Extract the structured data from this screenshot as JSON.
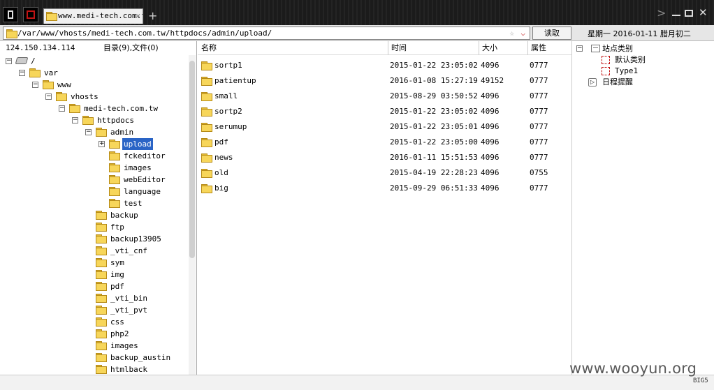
{
  "tab": {
    "title": "www.medi-tech.com.tw",
    "close": "✕",
    "new": "+"
  },
  "address": {
    "path": "/var/www/vhosts/medi-tech.com.tw/httpdocs/admin/upload/",
    "star": "☆",
    "dropdown": "⌵"
  },
  "read_button": "读取",
  "date_info": "星期一 2016-01-11 腊月初二",
  "left": {
    "ip": "124.150.134.114",
    "summary": "目录(9),文件(0)",
    "tree": [
      {
        "label": "/",
        "depth": 0,
        "toggle": "−",
        "icon": "drive"
      },
      {
        "label": "var",
        "depth": 1,
        "toggle": "−",
        "icon": "folder"
      },
      {
        "label": "www",
        "depth": 2,
        "toggle": "−",
        "icon": "folder"
      },
      {
        "label": "vhosts",
        "depth": 3,
        "toggle": "−",
        "icon": "folder"
      },
      {
        "label": "medi-tech.com.tw",
        "depth": 4,
        "toggle": "−",
        "icon": "folder"
      },
      {
        "label": "httpdocs",
        "depth": 5,
        "toggle": "−",
        "icon": "folder"
      },
      {
        "label": "admin",
        "depth": 6,
        "toggle": "−",
        "icon": "folder"
      },
      {
        "label": "upload",
        "depth": 7,
        "toggle": "+",
        "icon": "folder",
        "selected": true
      },
      {
        "label": "fckeditor",
        "depth": 7,
        "toggle": "",
        "icon": "folder"
      },
      {
        "label": "images",
        "depth": 7,
        "toggle": "",
        "icon": "folder"
      },
      {
        "label": "webEditor",
        "depth": 7,
        "toggle": "",
        "icon": "folder"
      },
      {
        "label": "language",
        "depth": 7,
        "toggle": "",
        "icon": "folder"
      },
      {
        "label": "test",
        "depth": 7,
        "toggle": "",
        "icon": "folder"
      },
      {
        "label": "backup",
        "depth": 6,
        "toggle": "",
        "icon": "folder"
      },
      {
        "label": "ftp",
        "depth": 6,
        "toggle": "",
        "icon": "folder"
      },
      {
        "label": "backup13905",
        "depth": 6,
        "toggle": "",
        "icon": "folder"
      },
      {
        "label": "_vti_cnf",
        "depth": 6,
        "toggle": "",
        "icon": "folder"
      },
      {
        "label": "sym",
        "depth": 6,
        "toggle": "",
        "icon": "folder"
      },
      {
        "label": "img",
        "depth": 6,
        "toggle": "",
        "icon": "folder"
      },
      {
        "label": "pdf",
        "depth": 6,
        "toggle": "",
        "icon": "folder"
      },
      {
        "label": "_vti_bin",
        "depth": 6,
        "toggle": "",
        "icon": "folder"
      },
      {
        "label": "_vti_pvt",
        "depth": 6,
        "toggle": "",
        "icon": "folder"
      },
      {
        "label": "css",
        "depth": 6,
        "toggle": "",
        "icon": "folder"
      },
      {
        "label": "php2",
        "depth": 6,
        "toggle": "",
        "icon": "folder"
      },
      {
        "label": "images",
        "depth": 6,
        "toggle": "",
        "icon": "folder"
      },
      {
        "label": "backup_austin",
        "depth": 6,
        "toggle": "",
        "icon": "folder"
      },
      {
        "label": "htmlback",
        "depth": 6,
        "toggle": "",
        "icon": "folder"
      }
    ]
  },
  "list": {
    "headers": {
      "name": "名称",
      "time": "时间",
      "size": "大小",
      "attr": "属性"
    },
    "rows": [
      {
        "name": "sortp1",
        "time": "2015-01-22 23:05:02",
        "size": "4096",
        "attr": "0777"
      },
      {
        "name": "patientup",
        "time": "2016-01-08 15:27:19",
        "size": "49152",
        "attr": "0777"
      },
      {
        "name": "small",
        "time": "2015-08-29 03:50:52",
        "size": "4096",
        "attr": "0777"
      },
      {
        "name": "sortp2",
        "time": "2015-01-22 23:05:02",
        "size": "4096",
        "attr": "0777"
      },
      {
        "name": "serumup",
        "time": "2015-01-22 23:05:01",
        "size": "4096",
        "attr": "0777"
      },
      {
        "name": "pdf",
        "time": "2015-01-22 23:05:00",
        "size": "4096",
        "attr": "0777"
      },
      {
        "name": "news",
        "time": "2016-01-11 15:51:53",
        "size": "4096",
        "attr": "0777"
      },
      {
        "name": "old",
        "time": "2015-04-19 22:28:23",
        "size": "4096",
        "attr": "0755"
      },
      {
        "name": "big",
        "time": "2015-09-29 06:51:33",
        "size": "4096",
        "attr": "0777"
      }
    ]
  },
  "right": {
    "site_category": "站点类别",
    "site_toggle": "−",
    "default_category": "默认类别",
    "type1": "Type1",
    "reminder": "日程提醒"
  },
  "watermark": "www.wooyun.org",
  "encoding": "BIG5",
  "colors": {
    "selection": "#2a64c6",
    "titlebar": "#1b1b1b",
    "folder": "#f7d65a"
  }
}
